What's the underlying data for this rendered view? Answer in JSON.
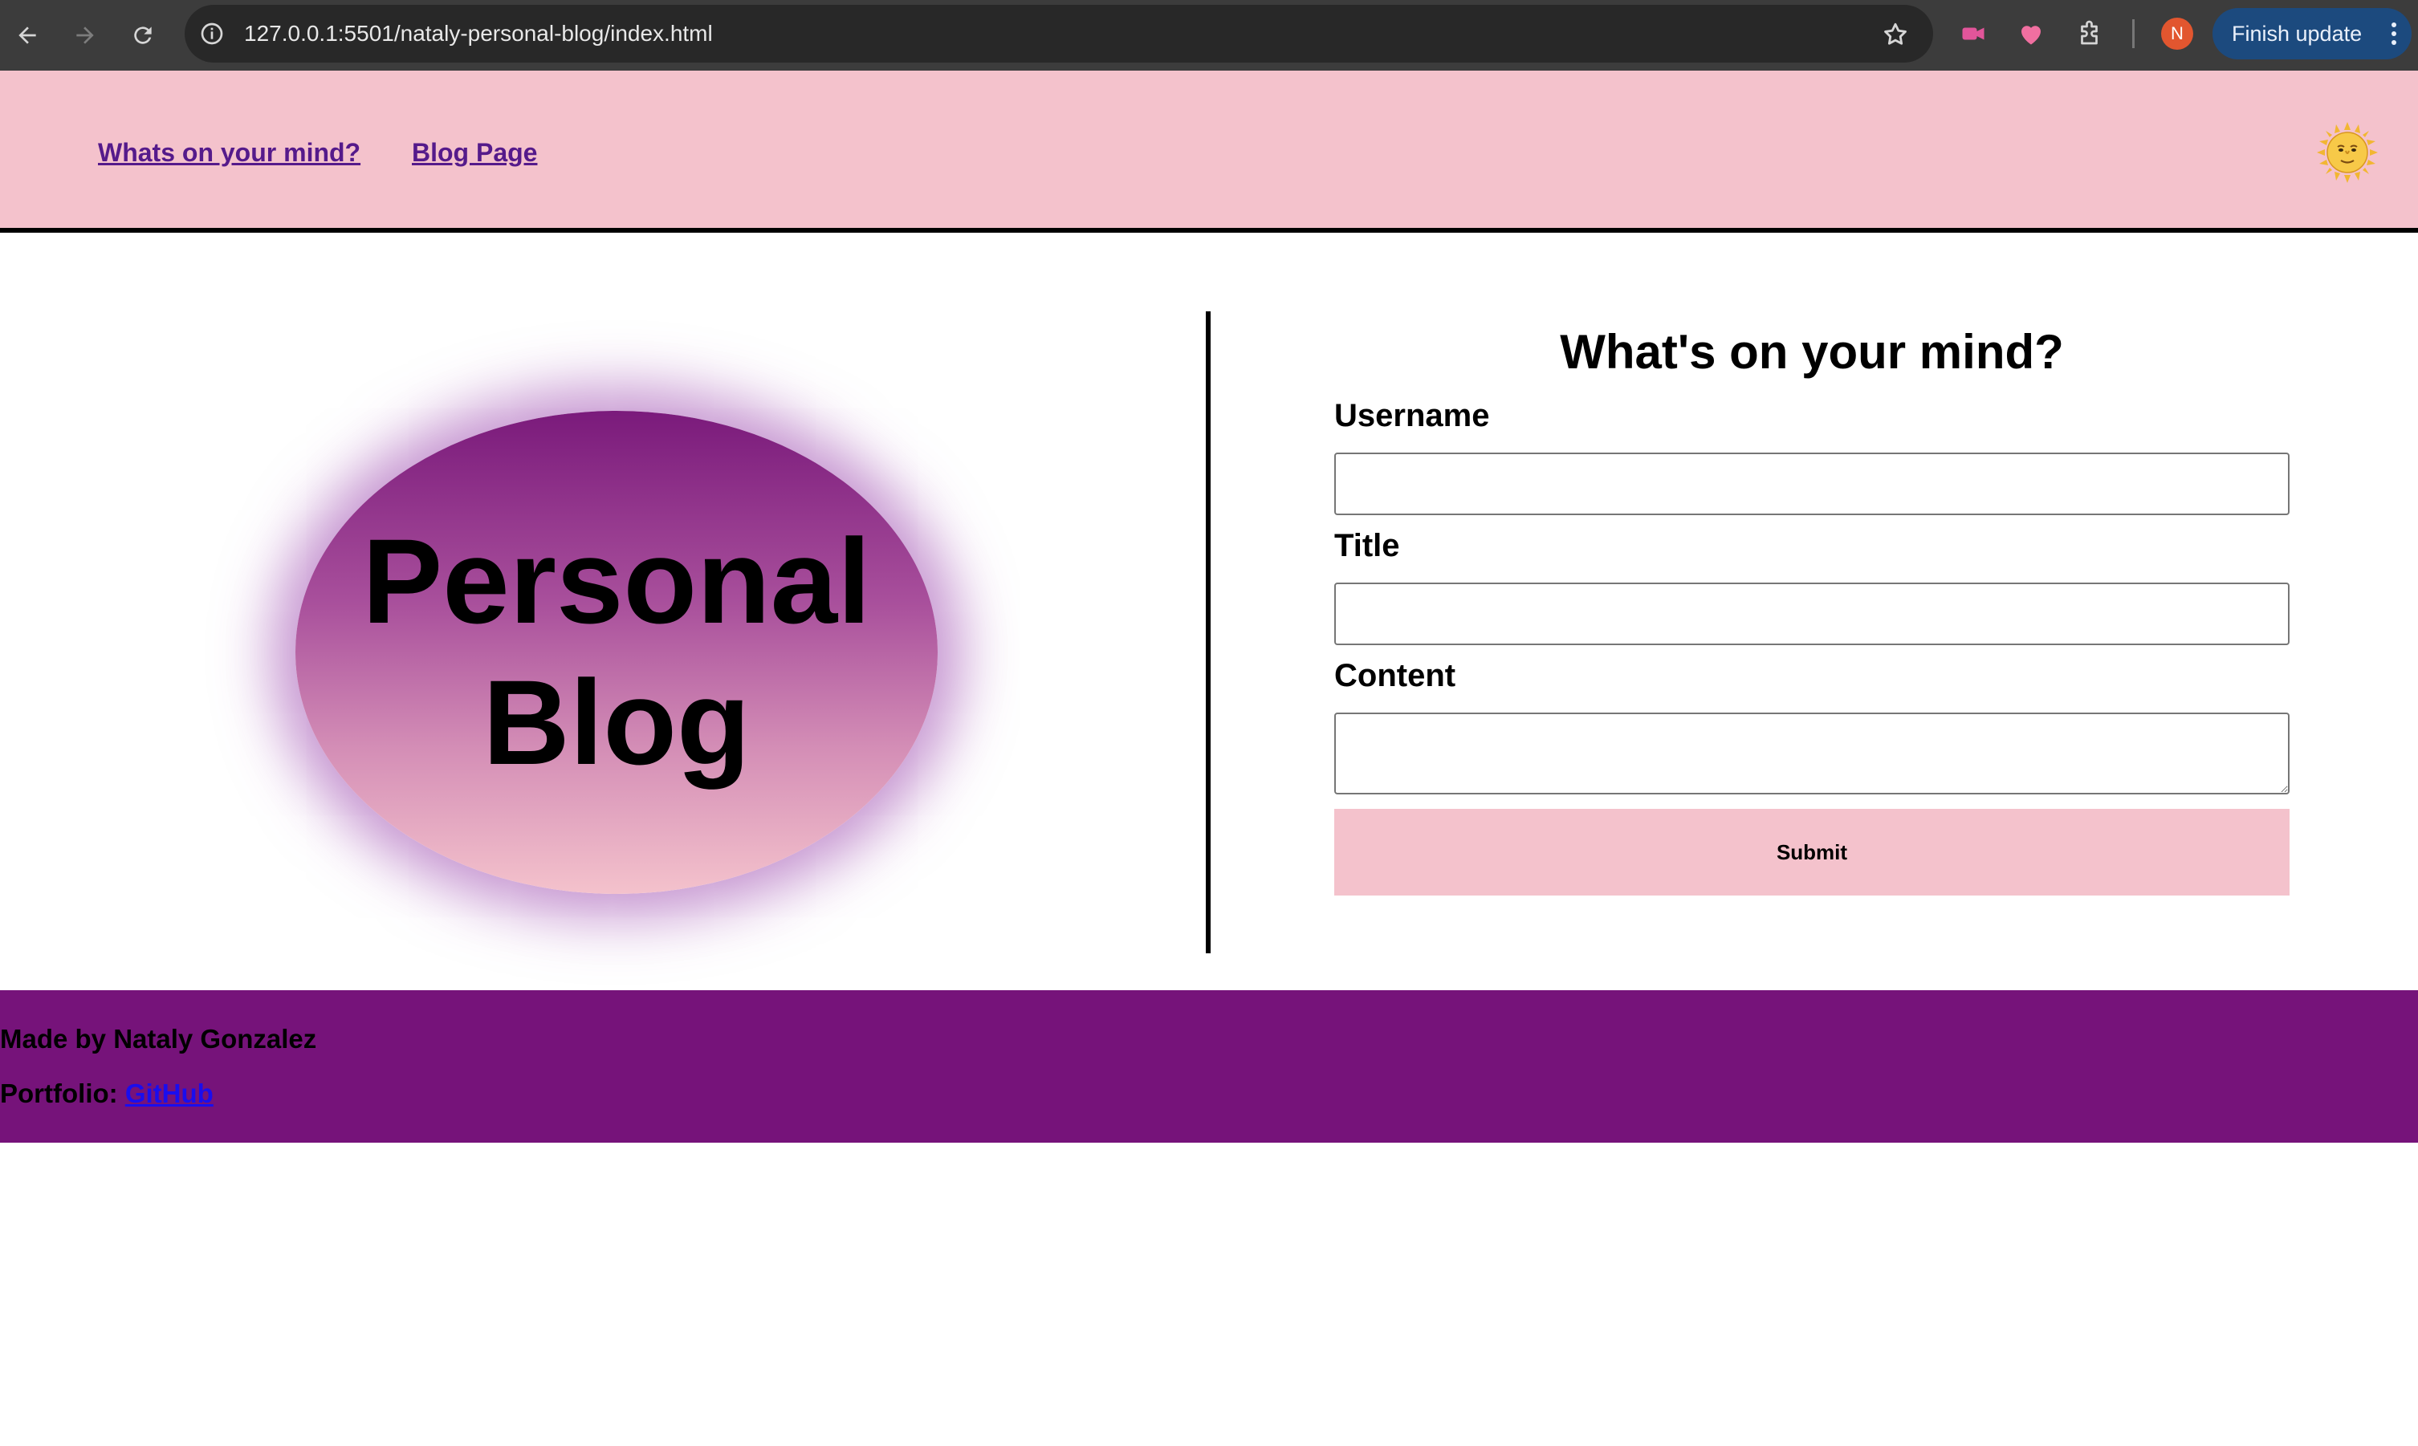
{
  "browser": {
    "url": "127.0.0.1:5501/nataly-personal-blog/index.html",
    "profile_initial": "N",
    "finish_update_label": "Finish update",
    "icons": {
      "back": "back-arrow-icon",
      "forward": "forward-arrow-icon",
      "reload": "reload-icon",
      "site_info": "site-info-icon",
      "bookmark": "star-icon",
      "extension_1": "video-record-icon",
      "extension_2": "heart-icon",
      "extensions": "puzzle-icon",
      "menu": "kebab-menu-icon"
    }
  },
  "header": {
    "nav": [
      {
        "label": "Whats on your mind?"
      },
      {
        "label": "Blog Page"
      }
    ],
    "theme_toggle_icon": "sun-face-icon"
  },
  "logo": {
    "line1": "Personal",
    "line2": "Blog"
  },
  "form": {
    "title": "What's on your mind?",
    "username_label": "Username",
    "username_value": "",
    "title_label": "Title",
    "title_value": "",
    "content_label": "Content",
    "content_value": "",
    "submit_label": "Submit"
  },
  "footer": {
    "made_by": "Made by Nataly Gonzalez",
    "portfolio_label": "Portfolio:",
    "portfolio_link": "GitHub"
  },
  "colors": {
    "header_bg": "#f4c2cc",
    "footer_bg": "#76137a",
    "nav_link": "#551a8b",
    "footer_link": "#1a0dee",
    "submit_bg": "#f4c2cc"
  }
}
